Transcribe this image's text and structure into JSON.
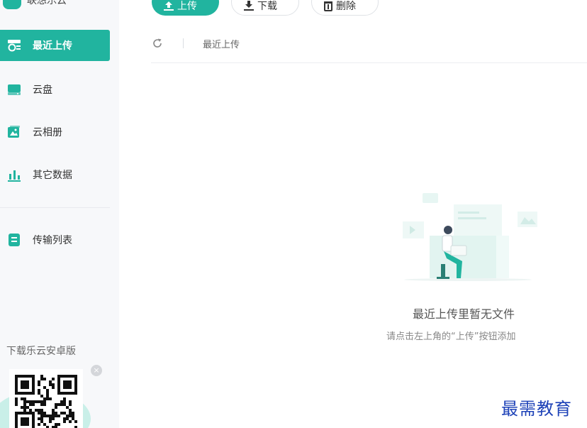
{
  "app": {
    "name": "联想乐云"
  },
  "toolbar": {
    "upload_label": "上传",
    "download_label": "下载",
    "delete_label": "删除"
  },
  "sidebar": {
    "items": [
      {
        "label": "最近上传",
        "icon": "recent-upload-icon",
        "active": true
      },
      {
        "label": "云盘",
        "icon": "cloud-disk-icon",
        "active": false
      },
      {
        "label": "云相册",
        "icon": "cloud-album-icon",
        "active": false
      },
      {
        "label": "其它数据",
        "icon": "bar-chart-icon",
        "active": false
      },
      {
        "label": "传输列表",
        "icon": "transfer-list-icon",
        "active": false
      }
    ],
    "download_promo": "下载乐云安卓版"
  },
  "breadcrumb": {
    "current": "最近上传"
  },
  "empty_state": {
    "title": "最近上传里暂无文件",
    "hint": "请点击左上角的“上传”按钮添加"
  },
  "watermark": "最需教育",
  "colors": {
    "accent": "#21b49f",
    "sidebar_bg": "#f7f8fa",
    "watermark": "#1f43b8"
  }
}
